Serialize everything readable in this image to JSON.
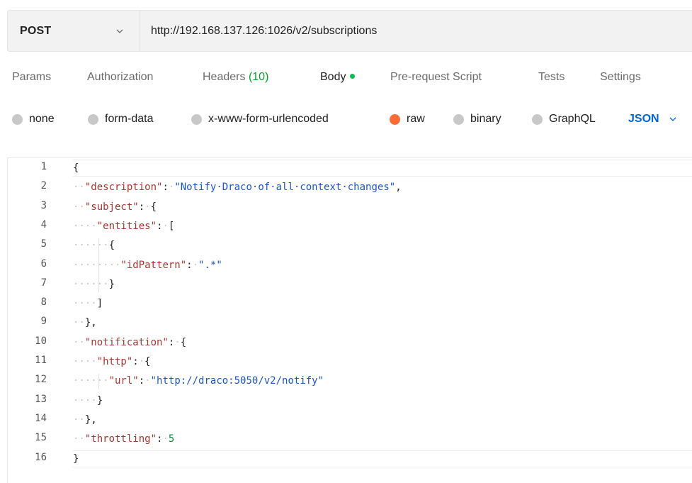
{
  "request": {
    "method": "POST",
    "url": "http://192.168.137.126:1026/v2/subscriptions"
  },
  "tabs": [
    {
      "label": "Params"
    },
    {
      "label": "Authorization"
    },
    {
      "label": "Headers",
      "count": "(10)"
    },
    {
      "label": "Body",
      "active": true,
      "indicator": "green-dot-icon"
    },
    {
      "label": "Pre-request Script"
    },
    {
      "label": "Tests"
    },
    {
      "label": "Settings"
    }
  ],
  "body_types": [
    {
      "label": "none",
      "selected": false
    },
    {
      "label": "form-data",
      "selected": false
    },
    {
      "label": "x-www-form-urlencoded",
      "selected": false
    },
    {
      "label": "raw",
      "selected": true
    },
    {
      "label": "binary",
      "selected": false
    },
    {
      "label": "GraphQL",
      "selected": false
    }
  ],
  "language": {
    "label": "JSON",
    "icon": "chevron-down-icon"
  },
  "colors": {
    "accent_orange": "#ff6c37",
    "json_blue": "#0265d2",
    "count_green": "#0c9d2c"
  },
  "editor": {
    "line_numbers": [
      "1",
      "2",
      "3",
      "4",
      "5",
      "6",
      "7",
      "8",
      "9",
      "10",
      "11",
      "12",
      "13",
      "14",
      "15",
      "16"
    ],
    "lines": [
      [
        {
          "t": "p",
          "v": "{"
        }
      ],
      [
        {
          "t": "w",
          "v": "··"
        },
        {
          "t": "k",
          "v": "\"description\""
        },
        {
          "t": "p",
          "v": ":"
        },
        {
          "t": "w",
          "v": "·"
        },
        {
          "t": "s",
          "v": "\"Notify·Draco·of·all·context·changes\""
        },
        {
          "t": "p",
          "v": ","
        }
      ],
      [
        {
          "t": "w",
          "v": "··"
        },
        {
          "t": "k",
          "v": "\"subject\""
        },
        {
          "t": "p",
          "v": ":"
        },
        {
          "t": "w",
          "v": "·"
        },
        {
          "t": "p",
          "v": "{"
        }
      ],
      [
        {
          "t": "w",
          "v": "····"
        },
        {
          "t": "k",
          "v": "\"entities\""
        },
        {
          "t": "p",
          "v": ":"
        },
        {
          "t": "w",
          "v": "·"
        },
        {
          "t": "p",
          "v": "["
        }
      ],
      [
        {
          "t": "w",
          "v": "······"
        },
        {
          "t": "p",
          "v": "{"
        }
      ],
      [
        {
          "t": "w",
          "v": "········"
        },
        {
          "t": "k",
          "v": "\"idPattern\""
        },
        {
          "t": "p",
          "v": ":"
        },
        {
          "t": "w",
          "v": "·"
        },
        {
          "t": "s",
          "v": "\".*\""
        }
      ],
      [
        {
          "t": "w",
          "v": "······"
        },
        {
          "t": "p",
          "v": "}"
        }
      ],
      [
        {
          "t": "w",
          "v": "····"
        },
        {
          "t": "p",
          "v": "]"
        }
      ],
      [
        {
          "t": "w",
          "v": "··"
        },
        {
          "t": "p",
          "v": "},"
        }
      ],
      [
        {
          "t": "w",
          "v": "··"
        },
        {
          "t": "k",
          "v": "\"notification\""
        },
        {
          "t": "p",
          "v": ":"
        },
        {
          "t": "w",
          "v": "·"
        },
        {
          "t": "p",
          "v": "{"
        }
      ],
      [
        {
          "t": "w",
          "v": "····"
        },
        {
          "t": "k",
          "v": "\"http\""
        },
        {
          "t": "p",
          "v": ":"
        },
        {
          "t": "w",
          "v": "·"
        },
        {
          "t": "p",
          "v": "{"
        }
      ],
      [
        {
          "t": "w",
          "v": "······"
        },
        {
          "t": "k",
          "v": "\"url\""
        },
        {
          "t": "p",
          "v": ":"
        },
        {
          "t": "w",
          "v": "·"
        },
        {
          "t": "s",
          "v": "\"http://draco:5050/v2/notify\""
        }
      ],
      [
        {
          "t": "w",
          "v": "····"
        },
        {
          "t": "p",
          "v": "}"
        }
      ],
      [
        {
          "t": "w",
          "v": "··"
        },
        {
          "t": "p",
          "v": "},"
        }
      ],
      [
        {
          "t": "w",
          "v": "··"
        },
        {
          "t": "k",
          "v": "\"throttling\""
        },
        {
          "t": "p",
          "v": ":"
        },
        {
          "t": "w",
          "v": "·"
        },
        {
          "t": "n",
          "v": "5"
        }
      ],
      [
        {
          "t": "p",
          "v": "}"
        }
      ]
    ]
  }
}
